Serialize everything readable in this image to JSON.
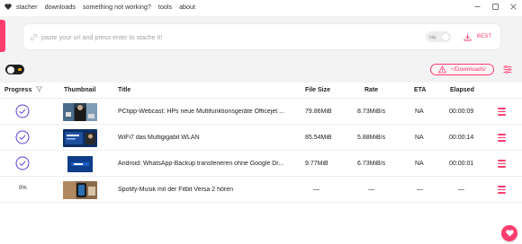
{
  "menu": {
    "items": [
      "stacher",
      "downloads",
      "something not working?",
      "tools",
      "about"
    ]
  },
  "url_bar": {
    "placeholder": "paste your url and press enter to stache it!",
    "clipboard_toggle_label": "Clip",
    "quality_label": "BEST"
  },
  "controls": {
    "download_dir": "~/Downloads/"
  },
  "table": {
    "headers": {
      "progress": "Progress",
      "thumbnail": "Thumbnail",
      "title": "Title",
      "file_size": "File Size",
      "rate": "Rate",
      "eta": "ETA",
      "elapsed": "Elapsed"
    },
    "rows": [
      {
        "status": "complete",
        "title": "PCtipp-Webcast: HPs neue Multifunktionsgeräte Officejet ...",
        "file_size": "79.86MiB",
        "rate": "8.73MiB/s",
        "eta": "NA",
        "elapsed": "00:00:09"
      },
      {
        "status": "complete",
        "title": "WiFi7 das Multigigabit WLAN",
        "file_size": "85.54MiB",
        "rate": "5.88MiB/s",
        "eta": "NA",
        "elapsed": "00:00:14"
      },
      {
        "status": "complete",
        "title": "Android: WhatsApp-Backup transferieren ohne Google Dr...",
        "file_size": "9.77MiB",
        "rate": "6.73MiB/s",
        "eta": "NA",
        "elapsed": "00:00:01"
      },
      {
        "status": "queued",
        "progress": "0%",
        "title": "Spotify-Musik mit der Fitbit Versa 2 hören",
        "file_size": "—",
        "rate": "—",
        "eta": "—",
        "elapsed": "—"
      }
    ]
  },
  "colors": {
    "accent": "#ff3d6e",
    "check": "#5b3fd6",
    "header_bg": "#f3f3f3"
  }
}
